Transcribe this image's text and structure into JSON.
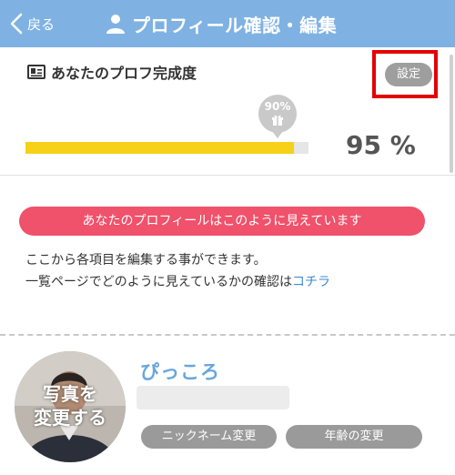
{
  "header": {
    "back_label": "戻る",
    "title": "プロフィール確認・編集",
    "bg_color": "#7fb2e3"
  },
  "completion": {
    "heading": "あなたのプロフ完成度",
    "settings_label": "設定",
    "bubble_text": "90%",
    "progress_fraction": 0.95,
    "percent_text": "95 %",
    "bar_color": "#f6d118"
  },
  "info": {
    "pill_text": "あなたのプロフィールはこのように見えています",
    "line1": "ここから各項目を編集する事ができます。",
    "line2_prefix": "一覧ページでどのように見えているかの確認は",
    "link_text": "コチラ",
    "pill_color": "#f0516b"
  },
  "profile": {
    "photo_label_1": "写真を",
    "photo_label_2": "変更する",
    "nickname": "ぴっころ",
    "nickname_button": "ニックネーム変更",
    "age_button": "年齢の変更"
  }
}
